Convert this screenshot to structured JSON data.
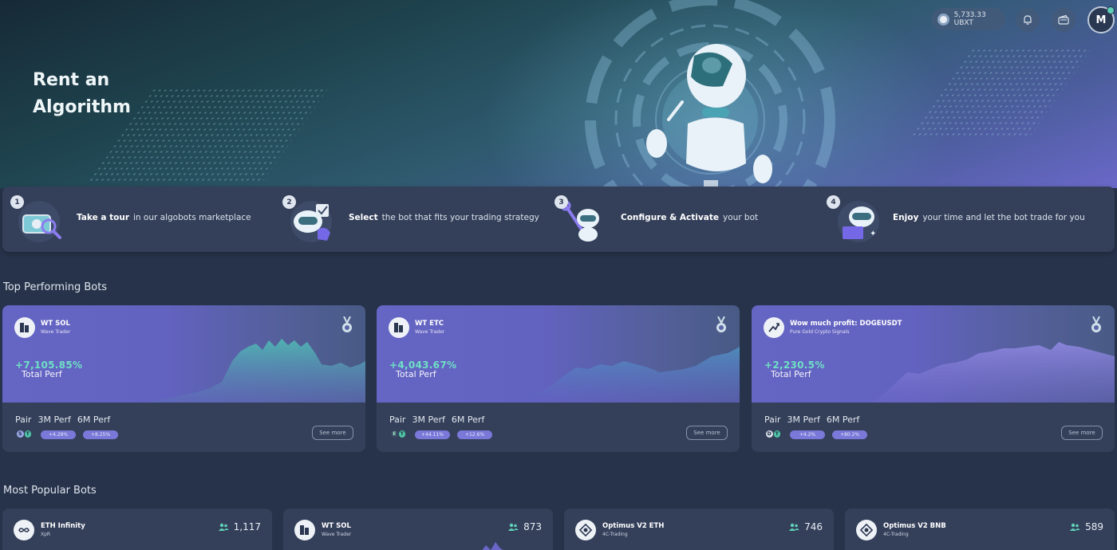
{
  "topbar": {
    "balance": "5,733.33 UBXT",
    "avatar_initial": "M",
    "icons": [
      "coin-icon",
      "bell-icon",
      "wallet-icon"
    ]
  },
  "hero": {
    "title": "Rent an Algorithm"
  },
  "steps": [
    {
      "num": "1",
      "bold": "Take a tour",
      "rest": "in our algobots marketplace",
      "icon": "tour-robot-icon"
    },
    {
      "num": "2",
      "bold": "Select",
      "rest": "the bot that fits your trading strategy",
      "icon": "select-robot-icon"
    },
    {
      "num": "3",
      "bold": "Configure & Activate",
      "rest": "your bot",
      "icon": "configure-robot-icon"
    },
    {
      "num": "4",
      "bold": "Enjoy",
      "rest": "your time and let the bot trade for you",
      "icon": "enjoy-robot-icon"
    }
  ],
  "sections": {
    "top_performing": "Top Performing Bots",
    "most_popular": "Most Popular Bots"
  },
  "top_bots": [
    {
      "name": "WT SOL",
      "provider": "Wave Trader",
      "total_perf": "+7,105.85%",
      "perf_label": "Total Perf",
      "pair_label": "Pair",
      "m3_label": "3M Perf",
      "m6_label": "6M Perf",
      "m3_value": "+4.28%",
      "m6_value": "+8.25%",
      "see_more": "See more"
    },
    {
      "name": "WT ETC",
      "provider": "Wave Trader",
      "total_perf": "+4,043.67%",
      "perf_label": "Total Perf",
      "pair_label": "Pair",
      "m3_label": "3M Perf",
      "m6_label": "6M Perf",
      "m3_value": "+44.11%",
      "m6_value": "+12.6%",
      "see_more": "See more"
    },
    {
      "name": "Wow much profit: DOGEUSDT",
      "provider": "Pure Gold Crypto Signals",
      "total_perf": "+2,230.5%",
      "perf_label": "Total Perf",
      "pair_label": "Pair",
      "m3_label": "3M Perf",
      "m6_label": "6M Perf",
      "m3_value": "+4.2%",
      "m6_value": "+80.2%",
      "see_more": "See more"
    }
  ],
  "popular_bots": [
    {
      "name": "ETH Infinity",
      "provider": "XpR",
      "count": "1,117"
    },
    {
      "name": "WT SOL",
      "provider": "Wave Trader",
      "count": "873"
    },
    {
      "name": "Optimus V2 ETH",
      "provider": "4C-Trading",
      "count": "746"
    },
    {
      "name": "Optimus V2 BNB",
      "provider": "4C-Trading",
      "count": "589"
    }
  ],
  "colors": {
    "accent_purple": "#6565c4",
    "perf_green": "#6fe0c5",
    "card_bg": "#34405a",
    "page_bg": "#27334a"
  }
}
